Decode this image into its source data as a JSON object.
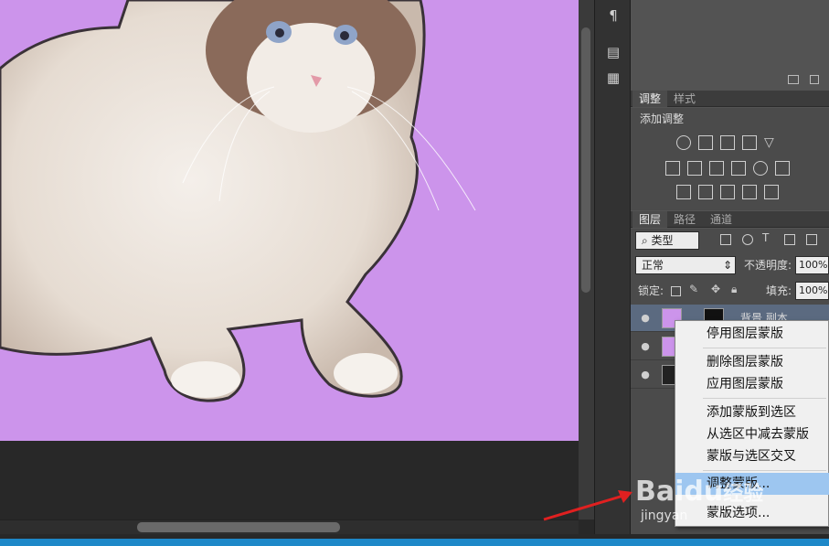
{
  "colors": {
    "canvas_bg": "#cc94eb",
    "accent": "#1e88c8",
    "menu_highlight": "#9dc6f0",
    "arrow": "#e02020"
  },
  "adjustments_panel": {
    "tabs": [
      "调整",
      "样式"
    ],
    "title": "添加调整",
    "icons_row1": [
      "brightness-icon",
      "levels-icon",
      "curves-icon",
      "exposure-icon",
      "vibrance-icon"
    ],
    "icons_row2": [
      "hue-saturation-icon",
      "color-balance-icon",
      "black-white-icon",
      "photo-filter-icon",
      "channel-mixer-icon",
      "color-lookup-icon"
    ],
    "icons_row3": [
      "invert-icon",
      "posterize-icon",
      "threshold-icon",
      "selective-color-icon",
      "gradient-map-icon"
    ]
  },
  "layers_panel": {
    "tabs": [
      "图层",
      "路径",
      "通道"
    ],
    "filter_kind": "类型",
    "blend_mode": "正常",
    "opacity_label": "不透明度:",
    "opacity_value": "100%",
    "lock_label": "锁定:",
    "fill_label": "填充:",
    "fill_value": "100%",
    "layers": [
      {
        "name": "背景 副本"
      },
      {
        "name": ""
      },
      {
        "name": ""
      }
    ]
  },
  "context_menu": {
    "items": [
      "停用图层蒙版",
      "删除图层蒙版",
      "应用图层蒙版",
      "添加蒙版到选区",
      "从选区中减去蒙版",
      "蒙版与选区交叉",
      "调整蒙版...",
      "蒙版选项..."
    ],
    "highlighted_index": 6
  },
  "watermark": {
    "brand": "Baidu",
    "brand_cn": "经验",
    "url": "jingyan"
  }
}
